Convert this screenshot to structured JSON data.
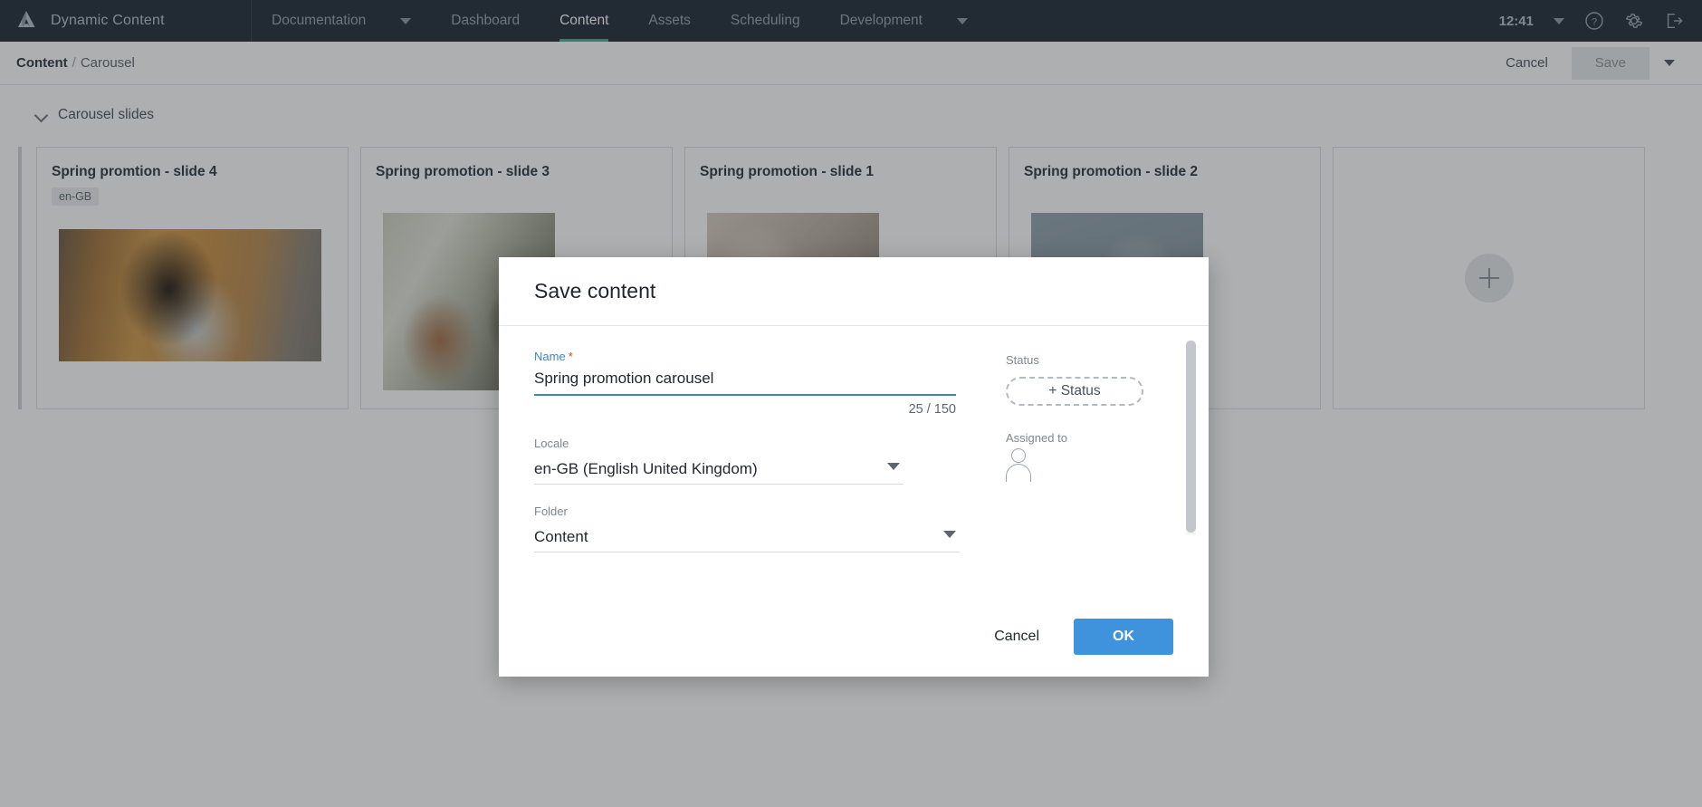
{
  "topbar": {
    "logo_icon": "amplience-logo-icon",
    "brand": "Dynamic Content",
    "nav": [
      {
        "label": "Documentation",
        "has_caret": true,
        "active": false
      },
      {
        "label": "Dashboard",
        "has_caret": false,
        "active": false
      },
      {
        "label": "Content",
        "has_caret": false,
        "active": true
      },
      {
        "label": "Assets",
        "has_caret": false,
        "active": false
      },
      {
        "label": "Scheduling",
        "has_caret": false,
        "active": false
      },
      {
        "label": "Development",
        "has_caret": true,
        "active": false
      }
    ],
    "clock": "12:41",
    "icons": [
      "chevron-down-icon",
      "help-icon",
      "gear-icon",
      "logout-icon"
    ],
    "active_accent": "#4aae9b",
    "background": "#1f2a37"
  },
  "breadcrumb": {
    "root": "Content",
    "separator": "/",
    "leaf": "Carousel",
    "cancel_label": "Cancel",
    "save_label": "Save"
  },
  "main": {
    "section_title": "Carousel slides",
    "cards": [
      {
        "title": "Spring promtion - slide 4",
        "locale": "en-GB",
        "photo": "ph4",
        "tall": false
      },
      {
        "title": "Spring promotion - slide 3",
        "locale": "",
        "photo": "ph3",
        "tall": true
      },
      {
        "title": "Spring promotion - slide 1",
        "locale": "",
        "photo": "ph1",
        "tall": true
      },
      {
        "title": "Spring promotion - slide 2",
        "locale": "",
        "photo": "ph2",
        "tall": true
      }
    ],
    "add_card_icon": "plus-icon"
  },
  "modal": {
    "title": "Save content",
    "name": {
      "label": "Name",
      "required_mark": "*",
      "value": "Spring promotion carousel",
      "counter": "25 / 150"
    },
    "locale": {
      "label": "Locale",
      "value": "en-GB (English United Kingdom)"
    },
    "folder": {
      "label": "Folder",
      "value": "Content"
    },
    "status": {
      "label": "Status",
      "button_label": "+ Status"
    },
    "assigned": {
      "label": "Assigned to",
      "icon": "person-icon"
    },
    "cancel_label": "Cancel",
    "ok_label": "OK",
    "ok_color": "#3f93dd",
    "focus_color": "#3f86c4"
  }
}
